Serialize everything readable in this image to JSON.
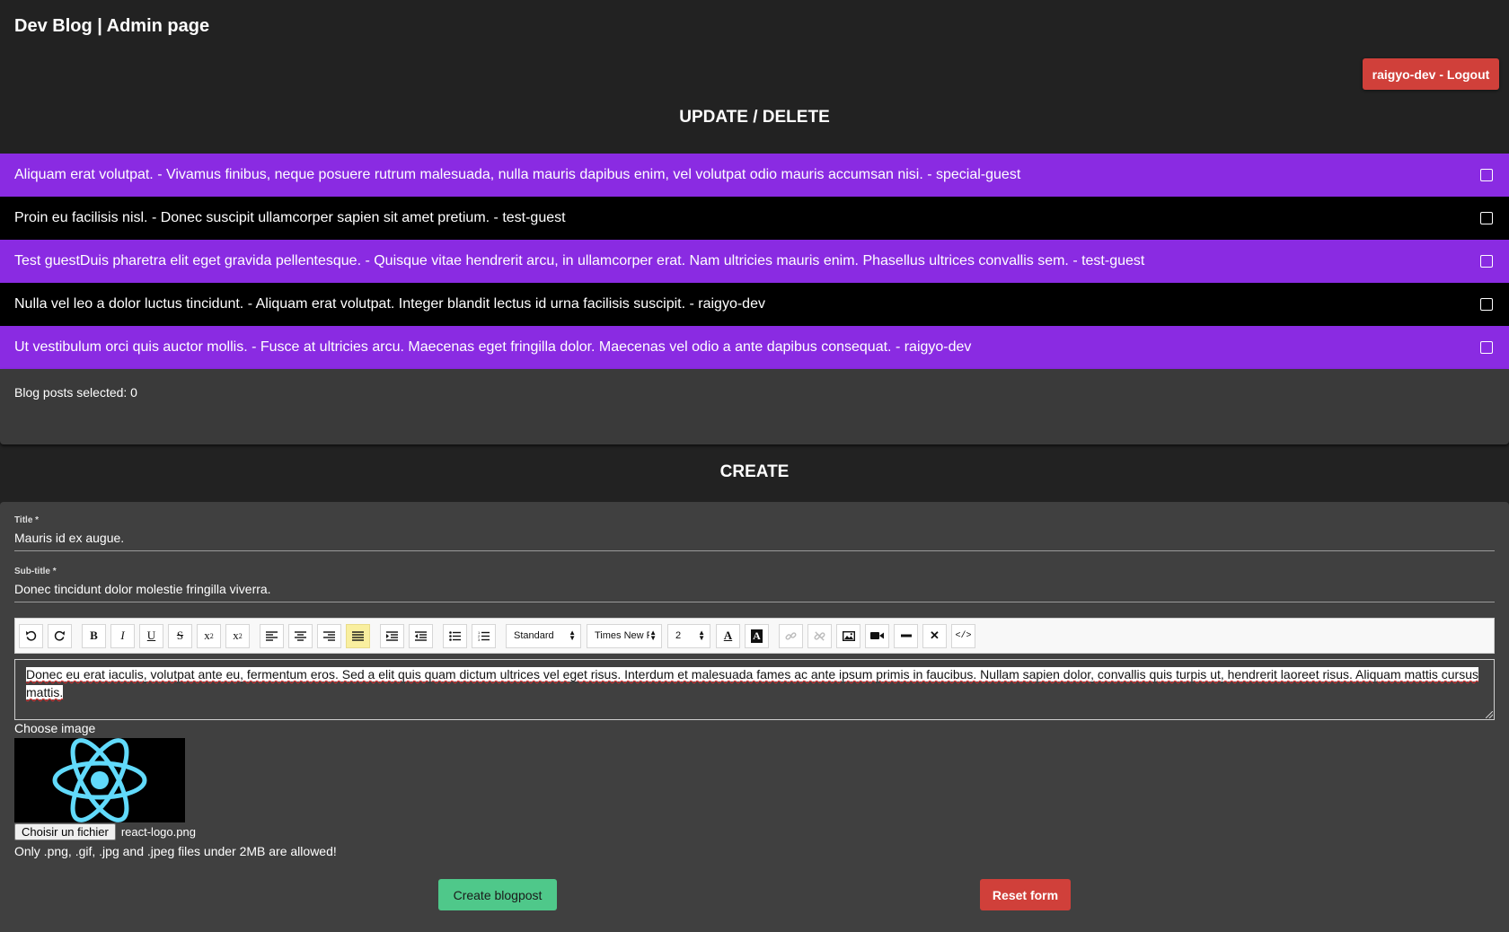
{
  "header": {
    "title": "Dev Blog | Admin page",
    "logout_label": "raigyo-dev - Logout"
  },
  "update_delete": {
    "title": "UPDATE / DELETE",
    "posts": [
      {
        "text": "Aliquam erat volutpat. - Vivamus finibus, neque posuere rutrum malesuada, nulla mauris dapibus enim, vel volutpat odio mauris accumsan nisi. - special-guest",
        "checked": false,
        "color": "#8a2be2"
      },
      {
        "text": "Proin eu facilisis nisl. - Donec suscipit ullamcorper sapien sit amet pretium. - test-guest",
        "checked": false,
        "color": "#000000"
      },
      {
        "text": "Test guestDuis pharetra elit eget gravida pellentesque. - Quisque vitae hendrerit arcu, in ullamcorper erat. Nam ultricies mauris enim. Phasellus ultrices convallis sem. - test-guest",
        "checked": false,
        "color": "#8a2be2"
      },
      {
        "text": "Nulla vel leo a dolor luctus tincidunt. - Aliquam erat volutpat. Integer blandit lectus id urna facilisis suscipit. - raigyo-dev",
        "checked": false,
        "color": "#000000"
      },
      {
        "text": "Ut vestibulum orci quis auctor mollis. - Fusce at ultricies arcu. Maecenas eget fringilla dolor. Maecenas vel odio a ante dapibus consequat. - raigyo-dev",
        "checked": false,
        "color": "#8a2be2"
      }
    ],
    "selected_label": "Blog posts selected: 0"
  },
  "create": {
    "title": "CREATE",
    "title_field": {
      "label": "Title *",
      "value": "Mauris id ex augue."
    },
    "subtitle_field": {
      "label": "Sub-title *",
      "value": "Donec tincidunt dolor molestie fringilla viverra."
    },
    "toolbar": {
      "paragraph_style": "Standard",
      "font_family": "Times New R",
      "font_size": "2",
      "icons": [
        "undo-icon",
        "redo-icon",
        "bold-icon",
        "italic-icon",
        "underline-icon",
        "strikethrough-icon",
        "subscript-icon",
        "superscript-icon",
        "align-left-icon",
        "align-center-icon",
        "align-right-icon",
        "align-justify-icon",
        "indent-icon",
        "outdent-icon",
        "bullet-list-icon",
        "numbered-list-icon",
        "font-color-icon",
        "highlight-color-icon",
        "link-icon",
        "unlink-icon",
        "image-icon",
        "video-icon",
        "horizontal-rule-icon",
        "clear-format-icon",
        "code-view-icon"
      ]
    },
    "editor_text": "Donec eu erat iaculis, volutpat ante eu, fermentum eros. Sed a elit quis quam dictum ultrices vel eget risus. Interdum et malesuada fames ac ante ipsum primis in faucibus. Nullam sapien dolor, convallis quis turpis ut, hendrerit laoreet risus. Aliquam mattis cursus mattis.",
    "choose_image_label": "Choose image",
    "file_button_label": "Choisir un fichier",
    "file_name": "react-logo.png",
    "file_hint": "Only .png, .gif, .jpg and .jpeg files under 2MB are allowed!",
    "create_button": "Create blogpost",
    "reset_button": "Reset form"
  },
  "colors": {
    "background": "#222222",
    "panel": "#404040",
    "row_purple": "#8a2be2",
    "row_black": "#000000",
    "danger": "#d0403a",
    "success": "#4fc88a",
    "react_blue": "#61dafb"
  }
}
